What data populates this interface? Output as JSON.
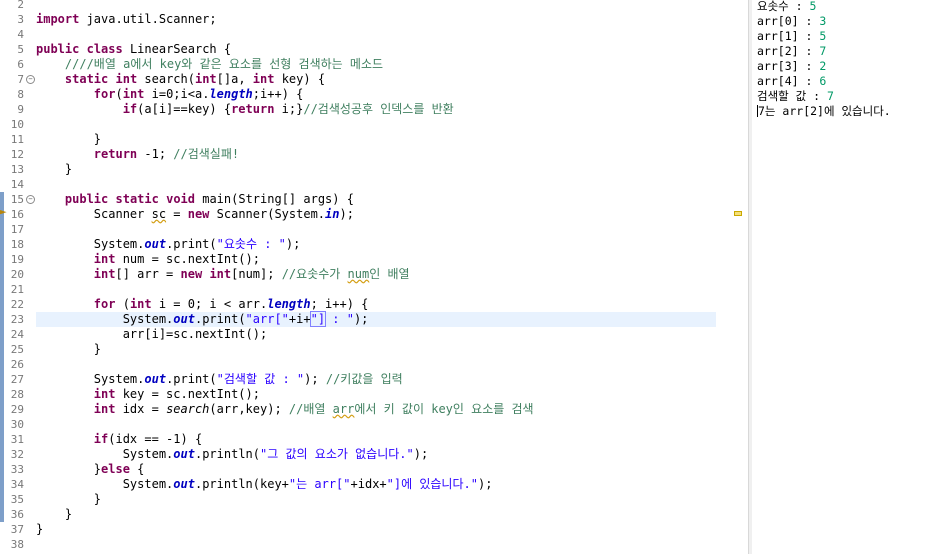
{
  "editor": {
    "line_numbers": [
      "2",
      "3",
      "4",
      "5",
      "6",
      "7",
      "8",
      "9",
      "10",
      "11",
      "12",
      "13",
      "14",
      "15",
      "16",
      "17",
      "18",
      "19",
      "20",
      "21",
      "22",
      "23",
      "24",
      "25",
      "26",
      "27",
      "28",
      "29",
      "30",
      "31",
      "32",
      "33",
      "34",
      "35",
      "36",
      "37",
      "38"
    ],
    "lines": {
      "l3": [
        "import",
        " java.util.Scanner;"
      ],
      "l5": [
        "public",
        " ",
        "class",
        " LinearSearch {"
      ],
      "l6": [
        "    ////배열 a에서 key와 같은 요소를 선형 검색하는 메소드"
      ],
      "l7": [
        "    ",
        "static",
        " ",
        "int",
        " search(",
        "int",
        "[]a, ",
        "int",
        " key) {"
      ],
      "l8": [
        "        ",
        "for",
        "(",
        "int",
        " i=0;i<a.",
        "length",
        ";i++) {"
      ],
      "l9": [
        "            ",
        "if",
        "(a[i]==key) {",
        "return",
        " i;}",
        "//검색성공후 인덱스를 반환"
      ],
      "l11": [
        "        }"
      ],
      "l12": [
        "        ",
        "return",
        " -1; ",
        "//검색실패!"
      ],
      "l13": [
        "    }"
      ],
      "l15": [
        "    ",
        "public",
        " ",
        "static",
        " ",
        "void",
        " main(String[] args) {"
      ],
      "l16": [
        "        Scanner ",
        "sc",
        " = ",
        "new",
        " Scanner(System.",
        "in",
        ");"
      ],
      "l18": [
        "        System.",
        "out",
        ".print(",
        "\"요솟수 : \"",
        ");"
      ],
      "l19": [
        "        ",
        "int",
        " num = sc.nextInt();"
      ],
      "l20": [
        "        ",
        "int",
        "[] arr = ",
        "new",
        " ",
        "int",
        "[num]; ",
        "//요솟수가 ",
        "num",
        "인 배열"
      ],
      "l22": [
        "        ",
        "for",
        " (",
        "int",
        " i = 0; i < arr.",
        "length",
        "; i++) {"
      ],
      "l23": [
        "            System.",
        "out",
        ".print(",
        "\"arr[\"",
        "+i+",
        "\"]",
        " : \"",
        ");"
      ],
      "l24": [
        "            arr[i]=sc.nextInt();"
      ],
      "l25": [
        "        }"
      ],
      "l27": [
        "        System.",
        "out",
        ".print(",
        "\"검색할 값 : \"",
        "); ",
        "//키값을 입력"
      ],
      "l28": [
        "        ",
        "int",
        " key = sc.nextInt();"
      ],
      "l29": [
        "        ",
        "int",
        " idx = ",
        "search",
        "(arr,key); ",
        "//배열 ",
        "arr",
        "에서 키 값이 key인 요소를 검색"
      ],
      "l31": [
        "        ",
        "if",
        "(idx == -1) {"
      ],
      "l32": [
        "            System.",
        "out",
        ".println(",
        "\"그 값의 요소가 없습니다.\"",
        ");"
      ],
      "l33": [
        "        }",
        "else",
        " {"
      ],
      "l34": [
        "            System.",
        "out",
        ".println(key+",
        "\"는 arr[\"",
        "+idx+",
        "\"]에 있습니다.\"",
        ");"
      ],
      "l35": [
        "        }"
      ],
      "l36": [
        "    }"
      ],
      "l37": [
        "}"
      ]
    }
  },
  "console": {
    "lines": [
      {
        "prompt": "요솟수 : ",
        "input": "5"
      },
      {
        "prompt": "arr[0] : ",
        "input": "3"
      },
      {
        "prompt": "arr[1] : ",
        "input": "5"
      },
      {
        "prompt": "arr[2] : ",
        "input": "7"
      },
      {
        "prompt": "arr[3] : ",
        "input": "2"
      },
      {
        "prompt": "arr[4] : ",
        "input": "6"
      },
      {
        "prompt": "검색할 값 : ",
        "input": "7"
      }
    ],
    "result": "7는 arr[2]에 있습니다."
  },
  "colors": {
    "keyword": "#7f0055",
    "string": "#2a00ff",
    "comment": "#3f7f5f",
    "field": "#0000c0",
    "console_input": "#009966",
    "current_line": "#e8f2fe"
  },
  "icons": {
    "fold": "fold-collapse-icon",
    "warning": "warning-marker-icon"
  }
}
